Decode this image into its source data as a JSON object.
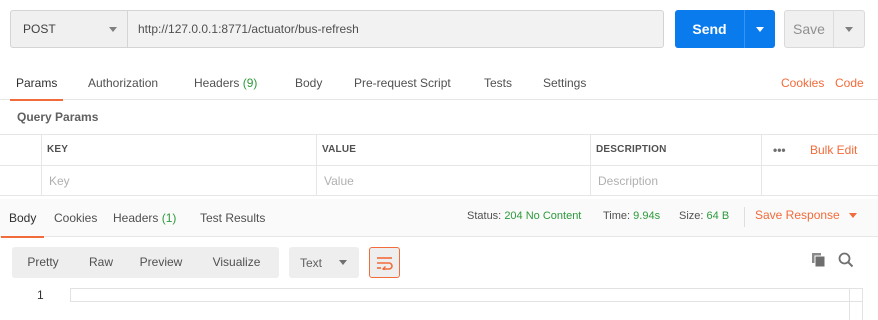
{
  "request": {
    "method": "POST",
    "url": "http://127.0.0.1:8771/actuator/bus-refresh",
    "send_label": "Send",
    "save_label": "Save"
  },
  "request_tabs": {
    "params": "Params",
    "authorization": "Authorization",
    "headers": "Headers",
    "headers_count": "(9)",
    "body": "Body",
    "prerequest": "Pre-request Script",
    "tests": "Tests",
    "settings": "Settings",
    "cookies": "Cookies",
    "code": "Code"
  },
  "query_params": {
    "title": "Query Params",
    "columns": {
      "key": "KEY",
      "value": "VALUE",
      "description": "DESCRIPTION"
    },
    "more": "•••",
    "bulk_edit": "Bulk Edit",
    "placeholders": {
      "key": "Key",
      "value": "Value",
      "description": "Description"
    }
  },
  "response_tabs": {
    "body": "Body",
    "cookies": "Cookies",
    "headers": "Headers",
    "headers_count": "(1)",
    "test_results": "Test Results"
  },
  "response_meta": {
    "status_label": "Status:",
    "status_value": "204 No Content",
    "time_label": "Time:",
    "time_value": "9.94s",
    "size_label": "Size:",
    "size_value": "64 B",
    "save_response": "Save Response"
  },
  "view": {
    "modes": [
      "Pretty",
      "Raw",
      "Preview",
      "Visualize"
    ],
    "format": "Text"
  },
  "editor": {
    "line_number": "1"
  },
  "colors": {
    "accent": "#f26b3a",
    "send_blue": "#097bed",
    "success_green": "#2d9a3c"
  }
}
